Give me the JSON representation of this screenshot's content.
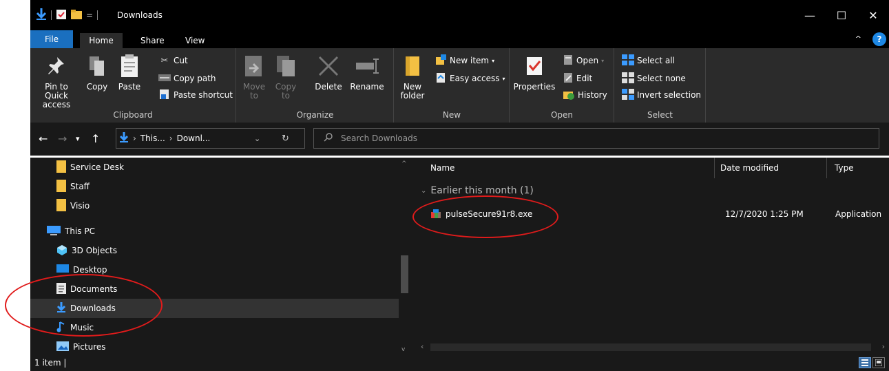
{
  "window": {
    "title": "Downloads",
    "controls": {
      "minimize": "—",
      "maximize": "☐",
      "close": "✕"
    }
  },
  "qat": {
    "dropdown": "="
  },
  "tabs": [
    {
      "label": "File"
    },
    {
      "label": "Home"
    },
    {
      "label": "Share"
    },
    {
      "label": "View"
    }
  ],
  "ribbon_toggle": "^",
  "help_label": "?",
  "ribbon": {
    "clipboard": {
      "label": "Clipboard",
      "pin": "Pin to Quick access",
      "copy": "Copy",
      "paste": "Paste",
      "cut": "Cut",
      "copy_path": "Copy path",
      "paste_shortcut": "Paste shortcut"
    },
    "organize": {
      "label": "Organize",
      "move_to": "Move to",
      "copy_to": "Copy to",
      "delete": "Delete",
      "rename": "Rename"
    },
    "new": {
      "label": "New",
      "new_folder": "New folder",
      "new_item": "New item",
      "easy_access": "Easy access"
    },
    "open": {
      "label": "Open",
      "properties": "Properties",
      "open": "Open",
      "edit": "Edit",
      "history": "History"
    },
    "select": {
      "label": "Select",
      "select_all": "Select all",
      "select_none": "Select none",
      "invert": "Invert selection"
    }
  },
  "address": {
    "path": [
      "This...",
      "Downl..."
    ],
    "search_placeholder": "Search Downloads"
  },
  "nav": {
    "items": [
      {
        "label": "Service Desk",
        "icon": "folder-icon"
      },
      {
        "label": "Staff",
        "icon": "folder-icon"
      },
      {
        "label": "Visio",
        "icon": "folder-icon"
      },
      {
        "label": "This PC",
        "icon": "this-pc-icon"
      },
      {
        "label": "3D Objects",
        "icon": "3d-objects-icon"
      },
      {
        "label": "Desktop",
        "icon": "desktop-icon"
      },
      {
        "label": "Documents",
        "icon": "documents-icon"
      },
      {
        "label": "Downloads",
        "icon": "downloads-icon"
      },
      {
        "label": "Music",
        "icon": "music-icon"
      },
      {
        "label": "Pictures",
        "icon": "pictures-icon"
      }
    ]
  },
  "content": {
    "columns": [
      "Name",
      "Date modified",
      "Type"
    ],
    "group_label": "Earlier this month (1)",
    "files": [
      {
        "name": "pulseSecure91r8.exe",
        "date": "12/7/2020 1:25 PM",
        "type": "Application"
      }
    ]
  },
  "status": {
    "item_count": "1 item",
    "separator": "|"
  },
  "colors": {
    "accent": "#1a6fbf",
    "background": "#191919",
    "ribbon": "#2b2b2b",
    "annotation": "#e01b1b",
    "folder": "#f3c043"
  }
}
